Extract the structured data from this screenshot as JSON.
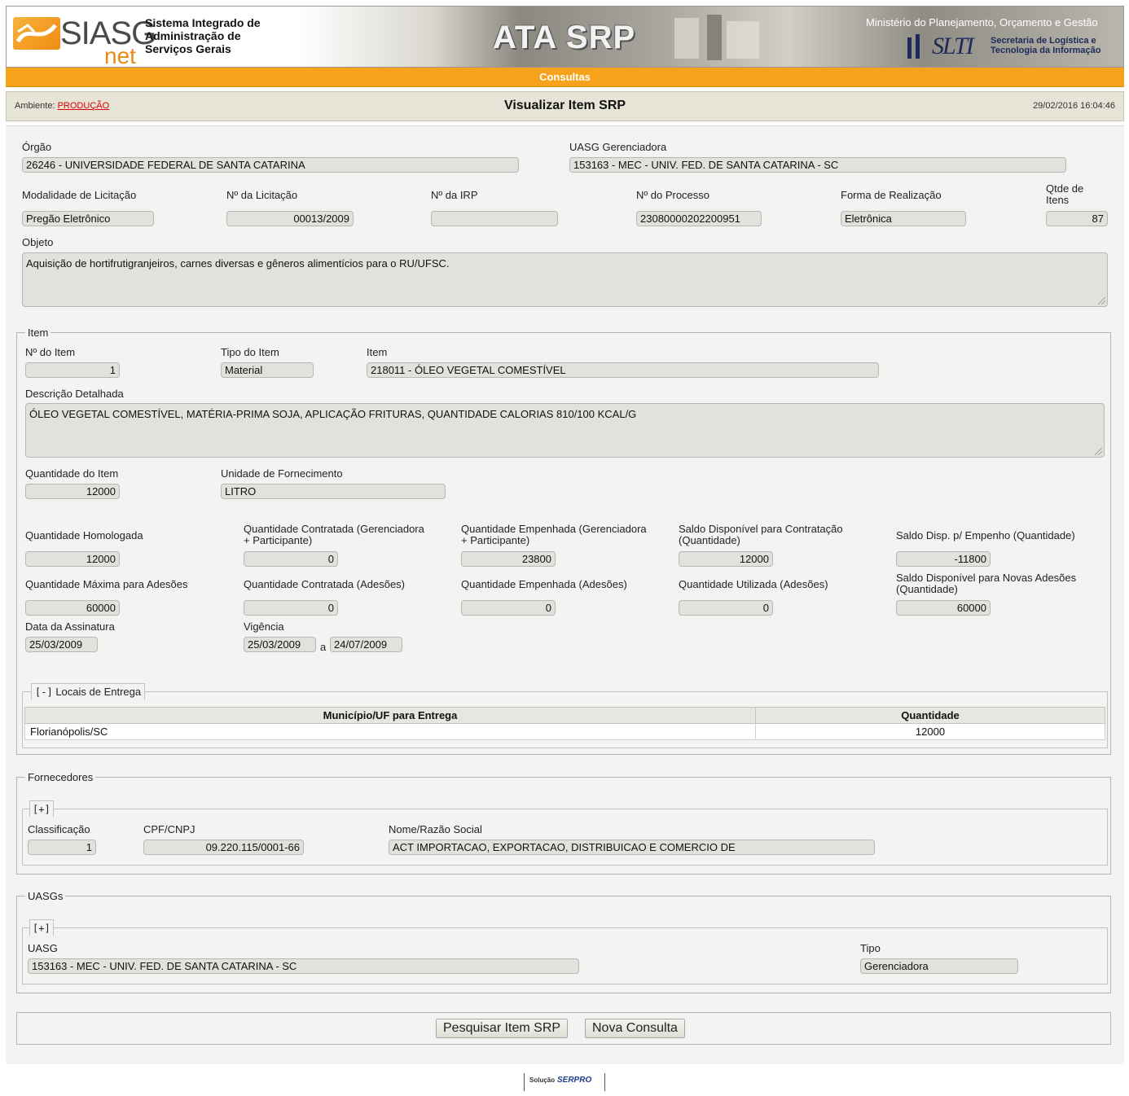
{
  "header": {
    "logo_siasg": "SIASG",
    "logo_net": "net",
    "system_name_line1": "Sistema Integrado de",
    "system_name_line2": "Administração de",
    "system_name_line3": "Serviços Gerais",
    "app_title": "ATA SRP",
    "ministerio": "Ministério do Planejamento, Orçamento e Gestão",
    "slti_logo": "SLTI",
    "slti_sub_line1": "Secretaria de Logística e",
    "slti_sub_line2": "Tecnologia da Informação"
  },
  "menu": {
    "consultas": "Consultas"
  },
  "titlebar": {
    "ambiente_label": "Ambiente:",
    "ambiente_value": "PRODUÇÃO",
    "title": "Visualizar Item SRP",
    "datetime": "29/02/2016 16:04:46"
  },
  "ata": {
    "orgao_label": "Órgão",
    "orgao_value": "26246 - UNIVERSIDADE FEDERAL DE SANTA CATARINA",
    "uasg_ger_label": "UASG Gerenciadora",
    "uasg_ger_value": "153163 - MEC - UNIV. FED. DE SANTA CATARINA - SC",
    "modalidade_label": "Modalidade de Licitação",
    "modalidade_value": "Pregão Eletrônico",
    "licitacao_label": "Nº da Licitação",
    "licitacao_value": "00013/2009",
    "irp_label": "Nº da IRP",
    "irp_value": "",
    "processo_label": "Nº do Processo",
    "processo_value": "23080000202200951",
    "forma_label": "Forma de Realização",
    "forma_value": "Eletrônica",
    "qtde_itens_label_line1": "Qtde de",
    "qtde_itens_label_line2": "Itens",
    "qtde_itens_value": "87",
    "objeto_label": "Objeto",
    "objeto_value": "Aquisição de hortifrutigranjeiros, carnes diversas e gêneros alimentícios para o RU/UFSC."
  },
  "item": {
    "legend": "Item",
    "num_label": "Nº do Item",
    "num_value": "1",
    "tipo_label": "Tipo do Item",
    "tipo_value": "Material",
    "item_label": "Item",
    "item_value": "218011 - ÓLEO VEGETAL COMESTÍVEL",
    "desc_label": "Descrição Detalhada",
    "desc_value": "ÓLEO VEGETAL COMESTÍVEL, MATÉRIA-PRIMA SOJA, APLICAÇÃO FRITURAS, QUANTIDADE CALORIAS 810/100 KCAL/G",
    "qtd_item_label": "Quantidade do Item",
    "qtd_item_value": "12000",
    "unidade_label": "Unidade de Fornecimento",
    "unidade_value": "LITRO",
    "qtd_homologada_label": "Quantidade Homologada",
    "qtd_homologada_value": "12000",
    "qtd_contratada_label_line1": "Quantidade Contratada (Gerenciadora",
    "qtd_contratada_label_line2": "+ Participante)",
    "qtd_contratada_value": "0",
    "qtd_empenhada_label_line1": "Quantidade Empenhada (Gerenciadora",
    "qtd_empenhada_label_line2": "+ Participante)",
    "qtd_empenhada_value": "23800",
    "saldo_contratacao_label_line1": "Saldo Disponível para Contratação",
    "saldo_contratacao_label_line2": "(Quantidade)",
    "saldo_contratacao_value": "12000",
    "saldo_empenho_label": "Saldo Disp. p/ Empenho (Quantidade)",
    "saldo_empenho_value": "-11800",
    "qtd_max_adesoes_label": "Quantidade Máxima para Adesões",
    "qtd_max_adesoes_value": "60000",
    "qtd_contratada_adesoes_label": "Quantidade Contratada (Adesões)",
    "qtd_contratada_adesoes_value": "0",
    "qtd_empenhada_adesoes_label": "Quantidade Empenhada (Adesões)",
    "qtd_empenhada_adesoes_value": "0",
    "qtd_utilizada_adesoes_label": "Quantidade Utilizada (Adesões)",
    "qtd_utilizada_adesoes_value": "0",
    "saldo_novas_adesoes_label_line1": "Saldo Disponível para Novas Adesões",
    "saldo_novas_adesoes_label_line2": "(Quantidade)",
    "saldo_novas_adesoes_value": "60000",
    "data_assinatura_label": "Data da Assinatura",
    "data_assinatura_value": "25/03/2009",
    "vigencia_label": "Vigência",
    "vigencia_inicio": "25/03/2009",
    "vigencia_sep": "a",
    "vigencia_fim": "24/07/2009"
  },
  "locais": {
    "toggle": "[-]",
    "legend": "Locais de Entrega",
    "columns": [
      "Município/UF para Entrega",
      "Quantidade"
    ],
    "rows": [
      {
        "municipio": "Florianópolis/SC",
        "quantidade": "12000"
      }
    ]
  },
  "fornecedores": {
    "legend": "Fornecedores",
    "toggle": "[+]",
    "classificacao_label": "Classificação",
    "classificacao_value": "1",
    "cnpj_label": "CPF/CNPJ",
    "cnpj_value": "09.220.115/0001-66",
    "nome_label": "Nome/Razão Social",
    "nome_value": "ACT IMPORTACAO, EXPORTACAO, DISTRIBUICAO E COMERCIO DE"
  },
  "uasgs": {
    "legend": "UASGs",
    "toggle": "[+]",
    "uasg_label": "UASG",
    "uasg_value": "153163 - MEC - UNIV. FED. DE SANTA CATARINA - SC",
    "tipo_label": "Tipo",
    "tipo_value": "Gerenciadora"
  },
  "actions": {
    "pesquisar": "Pesquisar Item SRP",
    "nova": "Nova Consulta"
  },
  "footer": {
    "selo": "Solução",
    "serpro": "SERPRO"
  },
  "colors": {
    "menu_orange": "#f7a21b",
    "titlebar_bg": "#e6e4d6",
    "field_bg": "#e2e2dc",
    "ambiente_red": "#dd0000"
  }
}
